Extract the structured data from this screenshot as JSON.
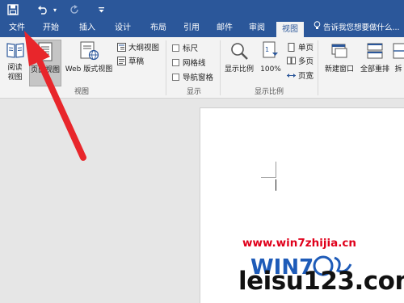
{
  "quick_access": {
    "icons": [
      "save-icon",
      "undo-icon",
      "redo-icon",
      "customize-icon"
    ]
  },
  "tabs": [
    {
      "label": "文件",
      "active": false
    },
    {
      "label": "开始",
      "active": false
    },
    {
      "label": "插入",
      "active": false
    },
    {
      "label": "设计",
      "active": false
    },
    {
      "label": "布局",
      "active": false
    },
    {
      "label": "引用",
      "active": false
    },
    {
      "label": "邮件",
      "active": false
    },
    {
      "label": "审阅",
      "active": false
    },
    {
      "label": "视图",
      "active": true
    }
  ],
  "tell_me": "告诉我您想要做什么...",
  "ribbon": {
    "views_group": {
      "label": "视图",
      "read_mode": "阅读\n视图",
      "print_layout": "页面视图",
      "web_layout": "Web 版式视图",
      "outline": "大纲视图",
      "draft": "草稿"
    },
    "show_group": {
      "label": "显示",
      "ruler": "标尺",
      "gridlines": "网格线",
      "nav_pane": "导航窗格"
    },
    "zoom_group": {
      "label": "显示比例",
      "zoom": "显示比例",
      "zoom_100": "100%",
      "one_page": "单页",
      "multi_page": "多页",
      "page_width": "页宽"
    },
    "window_group": {
      "new_window": "新建窗口",
      "arrange_all": "全部重排",
      "split": "拆"
    }
  },
  "watermark": {
    "url": "www.win7zhijia.cn",
    "site": "leisu123.com",
    "logo_text": "WIN7"
  },
  "colors": {
    "word_blue": "#2b579a",
    "ribbon_bg": "#f3f3f3",
    "arrow_red": "#e8262b",
    "watermark_red": "#e0001b"
  }
}
